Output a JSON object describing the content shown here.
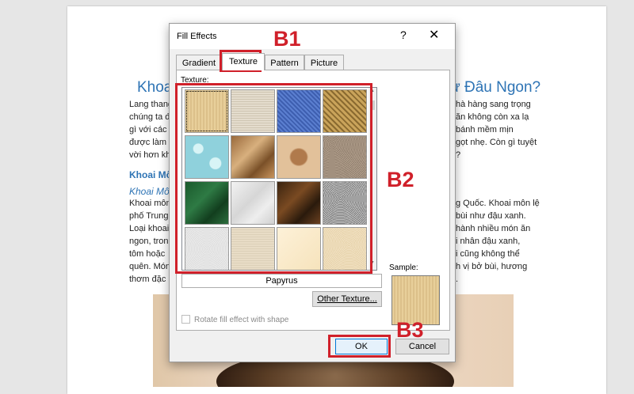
{
  "document": {
    "title_left": "Khoai",
    "title_right": "ử Đâu Ngon?",
    "left_lines": [
      "Lang thang",
      "chúng ta đ",
      "gì với các l",
      "được làm ",
      "vời hơn kh"
    ],
    "right_lines": [
      "hà hàng sang trọng",
      "ăn không còn xa lạ",
      "bánh mềm mịn",
      "gọt nhẹ. Còn gì tuyệt",
      "?"
    ],
    "heading2": "Khoai Mô",
    "heading3": "Khoai Mô",
    "left_lines2": [
      "Khoai môn",
      "phố Trung",
      "Loại khoai",
      "ngon, tron",
      "tôm hoặc ",
      "quên. Món",
      "thơm đặc "
    ],
    "right_lines2": [
      "g Quốc. Khoai môn lệ",
      "bùi như đậu xanh.",
      "hành nhiều món ăn",
      "i nhân đậu xanh,",
      "i cũng không thể",
      "h vị bở bùi, hương",
      "."
    ]
  },
  "dialog": {
    "title": "Fill Effects",
    "help": "?",
    "close": "✕",
    "tabs": [
      "Gradient",
      "Texture",
      "Pattern",
      "Picture"
    ],
    "active_tab": "Texture",
    "texture_label": "Texture:",
    "selected_texture": "Papyrus",
    "other_texture_button": "Other Texture...",
    "rotate_label": "Rotate fill effect with shape",
    "rotate_checked": false,
    "sample_label": "Sample:",
    "ok_label": "OK",
    "cancel_label": "Cancel",
    "scroll_up": "▲",
    "scroll_down": "▼"
  },
  "textures": [
    {
      "name": "papyrus",
      "css": "repeating-linear-gradient(90deg,#e8cf9a 0 2px,#dcc08a 2px 4px),#e6cc97"
    },
    {
      "name": "canvas",
      "css": "repeating-linear-gradient(0deg,#e4dccd 0 2px,#cfc5b2 2px 3px),#ddd3c1"
    },
    {
      "name": "denim",
      "css": "repeating-linear-gradient(45deg,#5b7fd0 0 2px,#3e5fb0 2px 4px),#4b6ec4"
    },
    {
      "name": "woven-mat",
      "css": "repeating-linear-gradient(45deg,#c9a35a 0 3px,#8a6a30 3px 5px),#b58e4a"
    },
    {
      "name": "water-droplets",
      "css": "radial-gradient(circle at 30% 30%,#d8f4f6 0 6px,transparent 7px),radial-gradient(circle at 70% 65%,#d8f4f6 0 7px,transparent 8px),#8fd1dc"
    },
    {
      "name": "paper-bag",
      "css": "linear-gradient(135deg,#9a6a3c,#d8b07e 40%,#7a5028 70%,#c9955e)"
    },
    {
      "name": "fish-fossil",
      "css": "radial-gradient(ellipse at 50% 50%,#b07a4c 0 10px,#e2c19a 12px),#e2c19a"
    },
    {
      "name": "sand",
      "css": "repeating-radial-gradient(circle at 20% 20%,#b5a28f 0 1px,#8e7d6c 1px 2px),#a89684"
    },
    {
      "name": "green-marble",
      "css": "linear-gradient(135deg,#1a5a2c,#2e7a44 40%,#123e1e 70%,#2c6e3e)"
    },
    {
      "name": "white-marble",
      "css": "linear-gradient(135deg,#f2f2f2,#d6d6d6 45%,#eeeeee 70%,#cfcfcf)"
    },
    {
      "name": "brown-marble",
      "css": "linear-gradient(135deg,#3a2410,#7a4a22 40%,#2a1a0c 70%,#6a4020)"
    },
    {
      "name": "granite",
      "css": "repeating-radial-gradient(circle at 40% 40%,#c8c8c8 0 1px,#7a7a7a 1px 2px),#a6a6a6"
    },
    {
      "name": "recycled-paper",
      "css": "repeating-radial-gradient(circle at 50% 50%,#ececec 0 1px,#dcdcdc 1px 2px),#e9e9e9"
    },
    {
      "name": "parchment",
      "css": "repeating-linear-gradient(0deg,#e8dcc6 0 2px,#dcd0b8 2px 3px),#e3d6be"
    },
    {
      "name": "stationery",
      "css": "linear-gradient(135deg,#fdf1d8,#f6e3bc)"
    },
    {
      "name": "cork",
      "css": "repeating-radial-gradient(circle at 60% 40%,#f2e2c4 0 1px,#e6d2aa 1px 2px),#efdcb8"
    }
  ],
  "annotations": {
    "b1": "B1",
    "b2": "B2",
    "b3": "B3"
  },
  "colors": {
    "accent": "#0078d7",
    "highlight": "#d0202a",
    "heading": "#2e74b5"
  }
}
